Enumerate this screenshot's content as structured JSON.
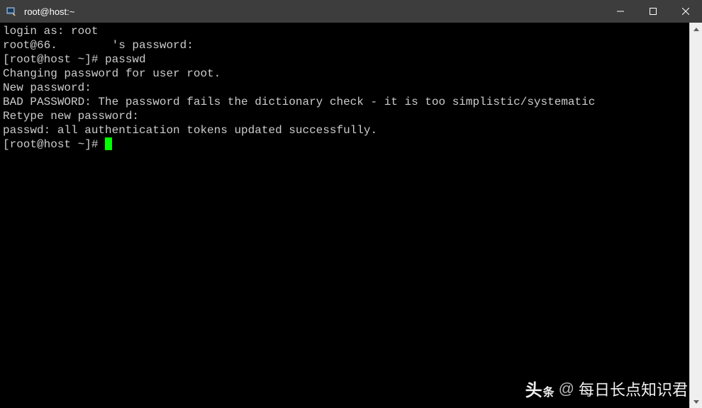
{
  "window": {
    "title": "root@host:~"
  },
  "terminal": {
    "lines": [
      "login as: root",
      "root@66.        's password:",
      "[root@host ~]# passwd",
      "Changing password for user root.",
      "New password:",
      "BAD PASSWORD: The password fails the dictionary check - it is too simplistic/systematic",
      "Retype new password:",
      "passwd: all authentication tokens updated successfully."
    ],
    "prompt": "[root@host ~]# "
  },
  "watermark": {
    "logo_main": "头",
    "logo_small": "条",
    "at": "@",
    "author": "每日长点知识君"
  }
}
